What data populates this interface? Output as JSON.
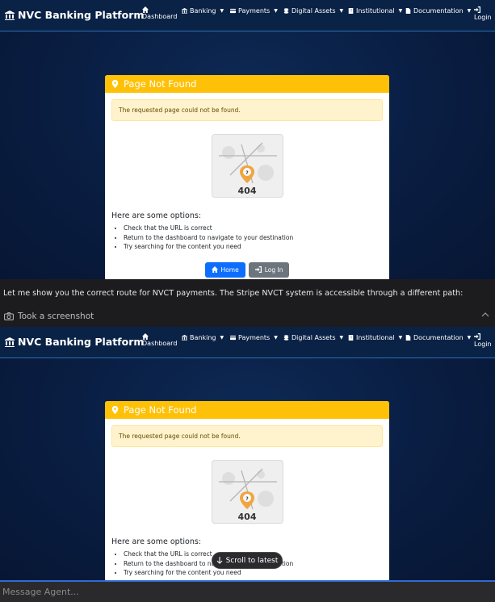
{
  "navbar": {
    "brand": "NVC Banking Platform",
    "items": [
      {
        "label": "Dashboard",
        "icon": "home-icon"
      },
      {
        "label": "Banking",
        "icon": "bank-icon"
      },
      {
        "label": "Payments",
        "icon": "credit-card-icon"
      },
      {
        "label": "Digital Assets",
        "icon": "coins-icon"
      },
      {
        "label": "Institutional",
        "icon": "building-icon"
      },
      {
        "label": "Documentation",
        "icon": "file-icon"
      },
      {
        "label": "Login",
        "icon": "sign-in-icon"
      }
    ]
  },
  "page": {
    "card_title": "Page Not Found",
    "alert": "The requested page could not be found.",
    "error_code": "404",
    "options_title": "Here are some options:",
    "options": [
      "Check that the URL is correct",
      "Return to the dashboard to navigate to your destination",
      "Try searching for the content you need"
    ],
    "home_button": "Home",
    "login_button": "Log In"
  },
  "chat": {
    "message": "Let me show you the correct route for NVCT payments. The Stripe NVCT system is accessible through a different path:",
    "tool_label": "Took a screenshot",
    "scroll_label": "Scroll to latest",
    "input_placeholder": "Message Agent..."
  },
  "colors": {
    "header_yellow": "#ffc107",
    "primary_blue": "#0d6efd",
    "secondary_gray": "#6c757d",
    "navbar_bg": "#0a2246"
  }
}
